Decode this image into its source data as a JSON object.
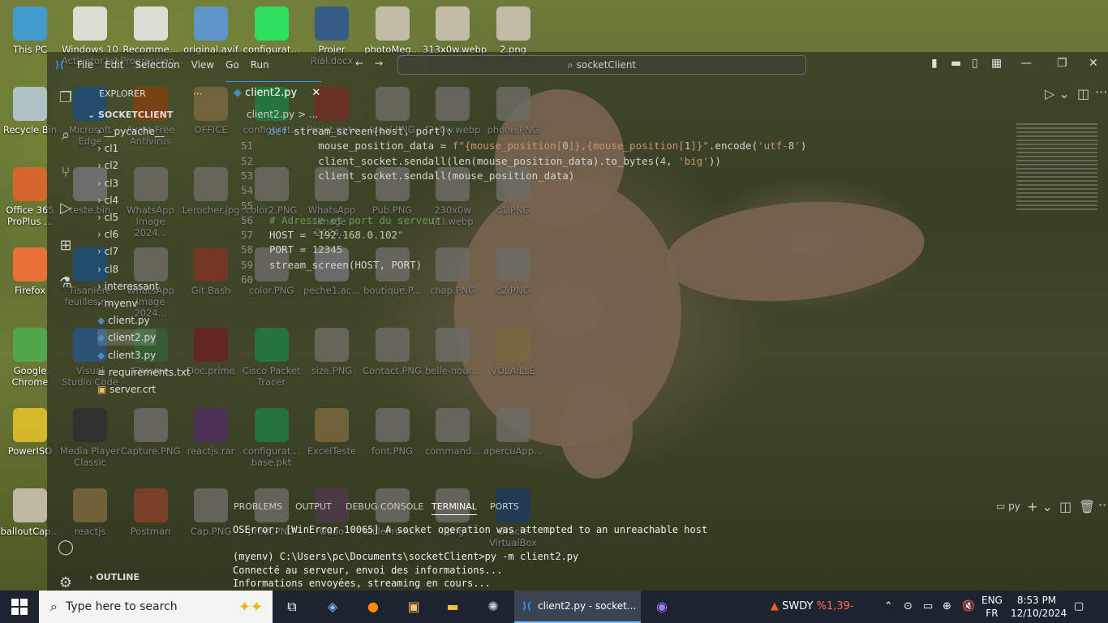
{
  "desktop_icons": [
    {
      "label": "This PC",
      "icon": "computer-icon"
    },
    {
      "label": "Recycle Bin",
      "icon": "recycle-bin-icon"
    },
    {
      "label": "Office 365 ProPlus ...",
      "icon": "office-icon"
    },
    {
      "label": "Firefox",
      "icon": "firefox-icon"
    },
    {
      "label": "Google Chrome",
      "icon": "chrome-icon"
    },
    {
      "label": "PowerISO",
      "icon": "disc-icon"
    },
    {
      "label": "balloutCap...",
      "icon": "image-icon"
    },
    {
      "label": "Windows 10 Activator.txt",
      "icon": "text-file-icon"
    },
    {
      "label": "Recomme... Progression...",
      "icon": "text-file-icon"
    },
    {
      "label": "original.avif",
      "icon": "image-file-icon"
    },
    {
      "label": "configurat...",
      "icon": "packet-tracer-icon"
    },
    {
      "label": "Projer Rial.docx",
      "icon": "word-icon"
    },
    {
      "label": "photoMeg...",
      "icon": "image-icon"
    },
    {
      "label": "313x0w.webp",
      "icon": "image-icon"
    },
    {
      "label": "2.png",
      "icon": "image-icon"
    },
    {
      "label": "Microsoft Edge",
      "icon": "edge-icon"
    },
    {
      "label": "Avast Free Antivirus",
      "icon": "avast-icon"
    },
    {
      "label": "OFFICE",
      "icon": "folder-icon"
    },
    {
      "label": "configurat...",
      "icon": "packet-tracer-icon"
    },
    {
      "label": "Projet.pptx",
      "icon": "powerpoint-icon"
    },
    {
      "label": "Ideal.PNG",
      "icon": "image-icon"
    },
    {
      "label": "f3x0w.webp",
      "icon": "image-icon"
    },
    {
      "label": "phone.PNG",
      "icon": "image-icon"
    },
    {
      "label": "teste.bin",
      "icon": "file-icon"
    },
    {
      "label": "WhatsApp Image 2024...",
      "icon": "image-icon"
    },
    {
      "label": "Lerocher.jpg",
      "icon": "image-icon"
    },
    {
      "label": "color2.PNG",
      "icon": "image-icon"
    },
    {
      "label": "WhatsApp Image 2024...",
      "icon": "image-icon"
    },
    {
      "label": "Pub.PNG",
      "icon": "image-icon"
    },
    {
      "label": "230x0w (1).webp",
      "icon": "image-icon"
    },
    {
      "label": "c1.PNG",
      "icon": "image-icon"
    },
    {
      "label": "Tisaniere feuilles n...",
      "icon": "edge-icon"
    },
    {
      "label": "WhatsApp Image 2024...",
      "icon": "image-icon"
    },
    {
      "label": "Git Bash",
      "icon": "git-icon"
    },
    {
      "label": "color.PNG",
      "icon": "image-icon"
    },
    {
      "label": "peche1.ac...",
      "icon": "file-icon"
    },
    {
      "label": "boutique.P...",
      "icon": "image-icon"
    },
    {
      "label": "chap.PNG",
      "icon": "image-icon"
    },
    {
      "label": "c2.PNG",
      "icon": "image-icon"
    },
    {
      "label": "Visual Studio Code",
      "icon": "vscode-icon"
    },
    {
      "label": "Chrome",
      "icon": "chrome-icon"
    },
    {
      "label": "Doc.prime",
      "icon": "pdf-icon"
    },
    {
      "label": "Cisco Packet Tracer",
      "icon": "packet-tracer-icon"
    },
    {
      "label": "size.PNG",
      "icon": "image-icon"
    },
    {
      "label": "Contact.PNG",
      "icon": "image-icon"
    },
    {
      "label": "belle-nour...",
      "icon": "image-icon"
    },
    {
      "label": "VOLAILLE",
      "icon": "folder-icon"
    },
    {
      "label": "Media Player Classic",
      "icon": "media-player-icon"
    },
    {
      "label": "Capture.PNG",
      "icon": "image-icon"
    },
    {
      "label": "reactjs.rar",
      "icon": "winrar-icon"
    },
    {
      "label": "configurat... base.pkt",
      "icon": "packet-tracer-icon"
    },
    {
      "label": "ExcelTeste",
      "icon": "folder-icon"
    },
    {
      "label": "font.PNG",
      "icon": "image-icon"
    },
    {
      "label": "command...",
      "icon": "image-icon"
    },
    {
      "label": "apercuApp...",
      "icon": "image-icon"
    },
    {
      "label": "reactjs",
      "icon": "folder-icon"
    },
    {
      "label": "Postman",
      "icon": "postman-icon"
    },
    {
      "label": "Cap.PNG",
      "icon": "image-icon"
    },
    {
      "label": "prodi.PNG",
      "icon": "image-icon"
    },
    {
      "label": "Odoo",
      "icon": "odoo-icon"
    },
    {
      "label": "tailleProdu...",
      "icon": "image-icon"
    },
    {
      "label": "i.png",
      "icon": "image-icon"
    },
    {
      "label": "Oracle VirtualBox",
      "icon": "virtualbox-icon"
    }
  ],
  "vscode": {
    "menu": [
      "File",
      "Edit",
      "Selection",
      "View",
      "Go",
      "Run"
    ],
    "search_text": "socketClient",
    "explorer_title": "EXPLORER",
    "project": "SOCKETCLIENT",
    "tree": [
      {
        "label": "__pycache__",
        "kind": "folder"
      },
      {
        "label": "cl1",
        "kind": "folder"
      },
      {
        "label": "cl2",
        "kind": "folder"
      },
      {
        "label": "cl3",
        "kind": "folder"
      },
      {
        "label": "cl4",
        "kind": "folder"
      },
      {
        "label": "cl5",
        "kind": "folder"
      },
      {
        "label": "cl6",
        "kind": "folder"
      },
      {
        "label": "cl7",
        "kind": "folder"
      },
      {
        "label": "cl8",
        "kind": "folder"
      },
      {
        "label": "interessant",
        "kind": "folder"
      },
      {
        "label": "myenv",
        "kind": "folder"
      },
      {
        "label": "client.py",
        "kind": "python"
      },
      {
        "label": "client2.py",
        "kind": "python"
      },
      {
        "label": "client3.py",
        "kind": "python"
      },
      {
        "label": "requirements.txt",
        "kind": "text"
      },
      {
        "label": "server.crt",
        "kind": "cert"
      }
    ],
    "outline_label": "OUTLINE",
    "tab_label": "client2.py",
    "breadcrumb": "client2.py > ...",
    "code": [
      {
        "ln": "",
        "text": "def stream_screen(host, port):"
      },
      {
        "ln": "51",
        "text": "        mouse_position_data = f\"{mouse_position[0]},{mouse_position[1]}\".encode('utf-8')"
      },
      {
        "ln": "52",
        "text": "        client_socket.sendall(len(mouse_position_data).to_bytes(4, 'big'))"
      },
      {
        "ln": "53",
        "text": "        client_socket.sendall(mouse_position_data)"
      },
      {
        "ln": "54",
        "text": ""
      },
      {
        "ln": "55",
        "text": ""
      },
      {
        "ln": "56",
        "text": "# Adresse et port du serveur"
      },
      {
        "ln": "57",
        "text": "HOST = \"192.168.0.102\""
      },
      {
        "ln": "58",
        "text": "PORT = 12345"
      },
      {
        "ln": "59",
        "text": "stream_screen(HOST, PORT)"
      },
      {
        "ln": "60",
        "text": ""
      }
    ],
    "panel_tabs": [
      "PROBLEMS",
      "OUTPUT",
      "DEBUG CONSOLE",
      "TERMINAL",
      "PORTS"
    ],
    "active_panel_tab": "TERMINAL",
    "terminal_shell": "py",
    "terminal": [
      "OSError: [WinError 10065] A socket operation was attempted to an unreachable host",
      "",
      "(myenv) C:\\Users\\pc\\Documents\\socketClient>py -m client2.py",
      "Connecté au serveur, envoi des informations...",
      "Informations envoyées, streaming en cours..."
    ]
  },
  "taskbar": {
    "search_placeholder": "Type here to search",
    "active_window": "client2.py - socket...",
    "stock_name": "SWDY",
    "stock_change": "%1,39-",
    "lang_top": "ENG",
    "lang_bottom": "FR",
    "time": "8:53 PM",
    "date": "12/10/2024"
  },
  "colors": {
    "keyword": "#569cd6",
    "function": "#dcdcaa",
    "string": "#ce9178",
    "comment": "#6a9955",
    "number": "#b5cea8",
    "accent": "#3794ff",
    "taskbar": "#1c2430"
  }
}
